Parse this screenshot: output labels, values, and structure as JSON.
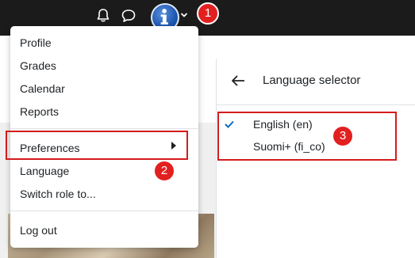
{
  "topbar": {
    "bell_icon": "bell-icon",
    "chat_icon": "chat-icon",
    "avatar_icon": "info-avatar-icon"
  },
  "annotations": {
    "badge_1": "1",
    "badge_2": "2",
    "badge_3": "3",
    "highlight_color": "#d41c1c",
    "badge_color": "#e22020"
  },
  "user_menu": {
    "items": [
      {
        "label": "Profile"
      },
      {
        "label": "Grades"
      },
      {
        "label": "Calendar"
      },
      {
        "label": "Reports"
      },
      {
        "label": "Preferences"
      },
      {
        "label": "Language"
      },
      {
        "label": "Switch role to..."
      },
      {
        "label": "Log out"
      }
    ]
  },
  "language_panel": {
    "title": "Language selector",
    "options": [
      {
        "label": "English (en)",
        "selected": true
      },
      {
        "label": "Suomi+ (fi_co)",
        "selected": false
      }
    ]
  }
}
